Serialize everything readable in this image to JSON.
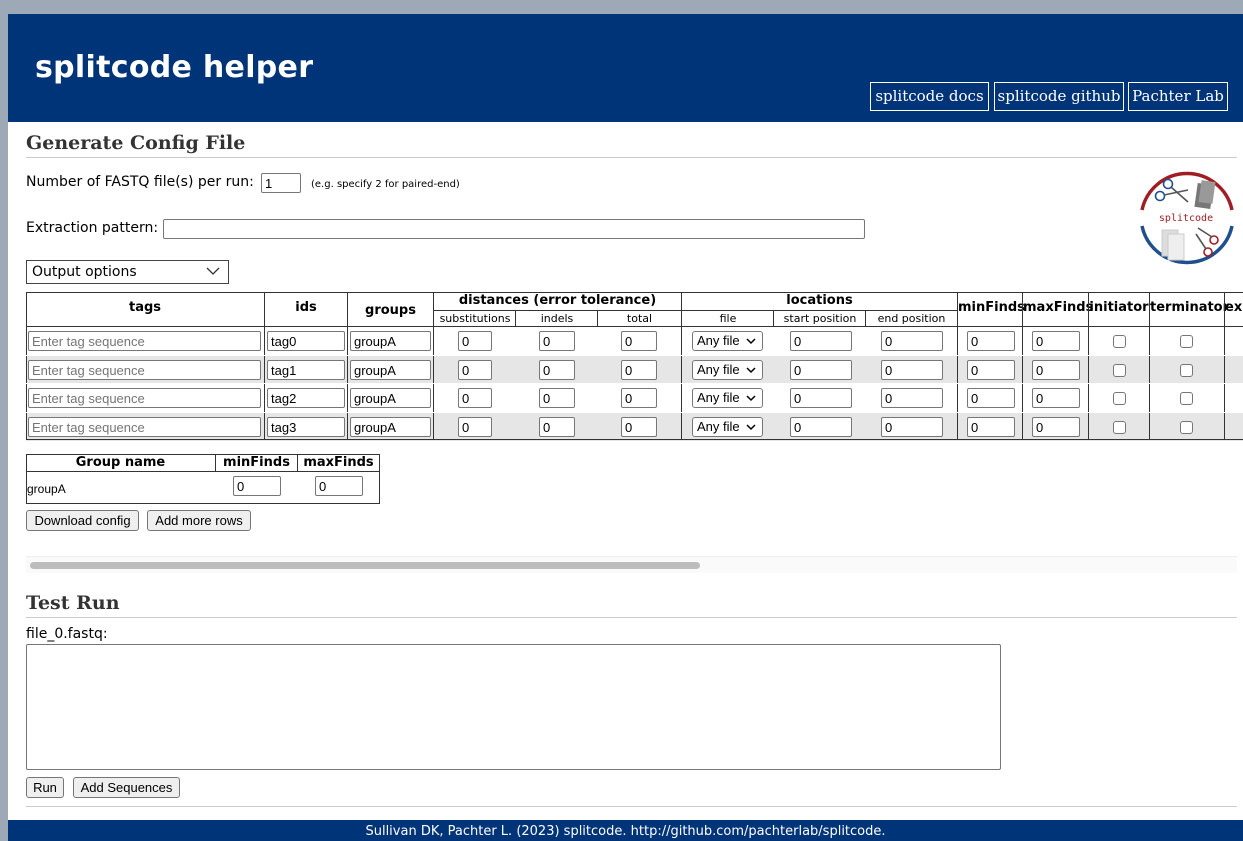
{
  "header": {
    "title": "splitcode helper",
    "links": [
      "splitcode docs",
      "splitcode github",
      "Pachter Lab"
    ]
  },
  "config_section": {
    "title": "Generate Config File",
    "fastq_label": "Number of FASTQ file(s) per run:",
    "fastq_value": "1",
    "fastq_hint": "(e.g. specify 2 for paired-end)",
    "extraction_label": "Extraction pattern:",
    "extraction_value": "",
    "output_options": "Output options",
    "logo_text": "splitcode"
  },
  "tags_table": {
    "headers": {
      "tags": "tags",
      "ids": "ids",
      "groups": "groups",
      "distances": "distances (error tolerance)",
      "locations": "locations",
      "minFinds": "minFinds",
      "maxFinds": "maxFinds",
      "initiator": "initiator",
      "terminator": "terminator",
      "extra": "ex"
    },
    "subheaders": {
      "substitutions": "substitutions",
      "indels": "indels",
      "total": "total",
      "file": "file",
      "start": "start position",
      "end": "end position"
    },
    "tag_placeholder": "Enter tag sequence",
    "rows": [
      {
        "id": "tag0",
        "group": "groupA",
        "substitutions": "0",
        "indels": "0",
        "total": "0",
        "file": "Any file",
        "start": "0",
        "end": "0",
        "minFinds": "0",
        "maxFinds": "0"
      },
      {
        "id": "tag1",
        "group": "groupA",
        "substitutions": "0",
        "indels": "0",
        "total": "0",
        "file": "Any file",
        "start": "0",
        "end": "0",
        "minFinds": "0",
        "maxFinds": "0"
      },
      {
        "id": "tag2",
        "group": "groupA",
        "substitutions": "0",
        "indels": "0",
        "total": "0",
        "file": "Any file",
        "start": "0",
        "end": "0",
        "minFinds": "0",
        "maxFinds": "0"
      },
      {
        "id": "tag3",
        "group": "groupA",
        "substitutions": "0",
        "indels": "0",
        "total": "0",
        "file": "Any file",
        "start": "0",
        "end": "0",
        "minFinds": "0",
        "maxFinds": "0"
      }
    ]
  },
  "group_table": {
    "headers": [
      "Group name",
      "minFinds",
      "maxFinds"
    ],
    "rows": [
      {
        "name": "groupA",
        "minFinds": "0",
        "maxFinds": "0"
      }
    ]
  },
  "buttons": {
    "download": "Download config",
    "add_rows": "Add more rows",
    "run": "Run",
    "add_sequences": "Add Sequences"
  },
  "test_section": {
    "title": "Test Run",
    "file_label": "file_0.fastq:",
    "file_value": ""
  },
  "footer": {
    "citation": "Sullivan DK, Pachter L. (2023) splitcode. http://github.com/pachterlab/splitcode."
  },
  "colors": {
    "header_bg": "#003478",
    "logo_red": "#a01e23",
    "logo_blue": "#1f4f8c",
    "alt_row": "#e6e6e6"
  }
}
